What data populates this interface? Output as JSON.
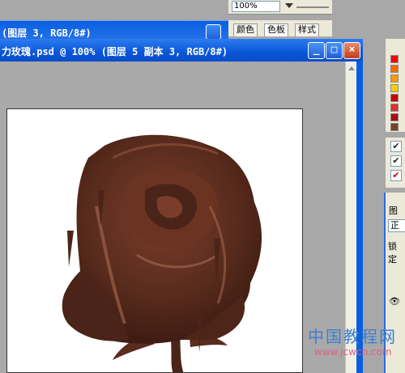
{
  "zoom_panel": {
    "value": "100%"
  },
  "back_window": {
    "title": "(图层 3, RGB/8#)"
  },
  "color_panel": {
    "tabs": [
      "颜色",
      "色板",
      "样式"
    ],
    "active_index": 1
  },
  "main_window": {
    "title": "力玫瑰.psd @ 100% (图层 5 副本 3, RGB/8#)",
    "min_label": "_",
    "max_label": "□",
    "close_label": "×"
  },
  "swatch_colors": [
    "#ff0000",
    "#ff6600",
    "#ff9900",
    "#ffcc00",
    "#cc0000",
    "#e03030",
    "#c05050",
    "#cc3300",
    "#aa1010",
    "#996633",
    "#774422",
    "#553311"
  ],
  "layer_checks": [
    "✔",
    "✔",
    "✔"
  ],
  "layers_panel": {
    "tab": "图",
    "mode": "正常",
    "lock": "锁定"
  },
  "watermark": {
    "cn": "中国教程网",
    "url": "www.jcwcn.com"
  },
  "colors": {
    "titlebar": "#0a56d8",
    "rose_dark": "#4a2418",
    "rose_mid": "#7a3d2a",
    "rose_light": "#a86a52"
  }
}
